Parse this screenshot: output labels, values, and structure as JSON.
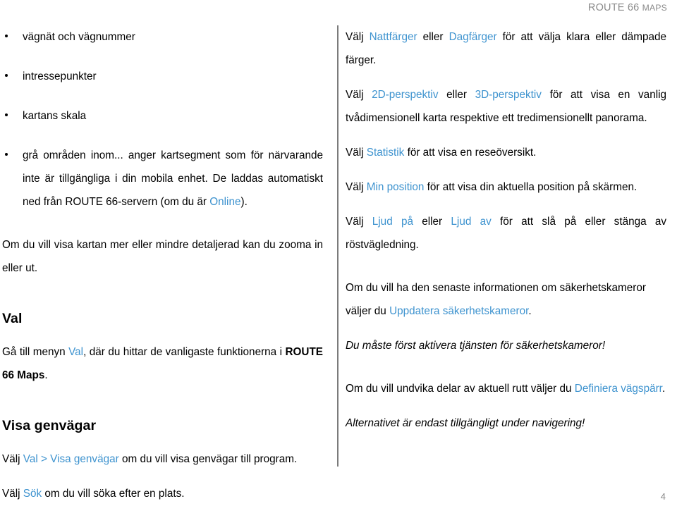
{
  "header": {
    "title_main": "ROUTE 66 ",
    "title_smallcaps": "MAPS"
  },
  "footer": {
    "page_number": "4"
  },
  "colors": {
    "link": "#3e93cf",
    "header_gray": "#8a8a8a",
    "divider": "#7b7b7b",
    "text": "#000000"
  },
  "left_column": {
    "bullets": [
      {
        "text": "vägnät och vägnummer"
      },
      {
        "text": "intressepunkter"
      },
      {
        "text": "kartans skala"
      },
      {
        "pre": "grå områden inom... anger kartsegment som för närvarande inte är tillgängliga i din mobila enhet. De laddas automatiskt ned från ROUTE 66-servern (om du är ",
        "link": "Online",
        "post": ")."
      }
    ],
    "para_zoom": "Om du vill visa kartan mer eller mindre detaljerad kan du zooma in eller ut.",
    "heading_val": "Val",
    "para_val": {
      "pre": "Gå till menyn ",
      "link": "Val",
      "mid": ", där du hittar de vanligaste funktionerna i ",
      "bold": "ROUTE 66 Maps",
      "post": "."
    },
    "heading_shortcuts": "Visa genvägar",
    "para_shortcuts": {
      "pre": "Välj ",
      "link": "Val > Visa genvägar",
      "post": " om du vill visa genvägar till program."
    },
    "para_search": {
      "pre": "Välj ",
      "link": "Sök",
      "post": " om du vill söka efter en plats."
    }
  },
  "right_column": {
    "para_colors": {
      "pre": "Välj ",
      "link1": "Nattfärger",
      "mid": " eller ",
      "link2": "Dagfärger",
      "post": " för att välja klara eller dämpade färger."
    },
    "para_perspective": {
      "pre": "Välj ",
      "link1": "2D-perspektiv",
      "mid": " eller ",
      "link2": "3D-perspektiv",
      "post": " för att visa en vanlig tvådimensionell karta respektive ett tredimensionellt panorama."
    },
    "para_stats": {
      "pre": "Välj ",
      "link": "Statistik",
      "post": " för att visa en reseöversikt."
    },
    "para_position": {
      "pre": "Välj ",
      "link": "Min position",
      "post": " för att visa din aktuella position på skärmen."
    },
    "para_sound": {
      "pre": "Välj ",
      "link1": "Ljud på",
      "mid": " eller ",
      "link2": "Ljud av",
      "post": " för att slå på eller stänga av röstvägledning."
    },
    "para_cameras": {
      "pre": "Om du vill ha den senaste informationen om säkerhetskameror väljer du ",
      "link": "Uppdatera säkerhetskameror",
      "post": "."
    },
    "note_cameras": "Du måste först aktivera tjänsten för säkerhetskameror!",
    "para_roadblock": {
      "pre": "Om du vill undvika delar av aktuell rutt väljer du ",
      "link": "Definiera vägspärr",
      "post": "."
    },
    "note_roadblock": "Alternativet är endast tillgängligt under navigering!"
  }
}
